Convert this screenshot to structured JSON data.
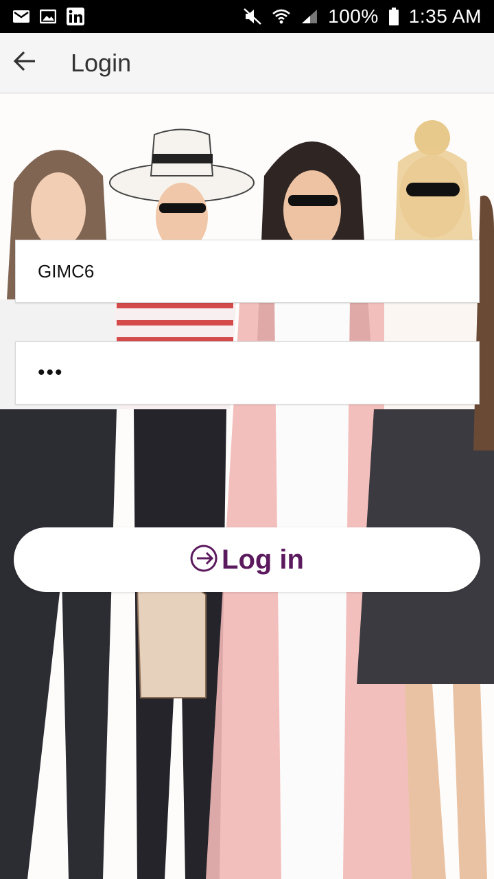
{
  "status_bar": {
    "left_icons": [
      "gmail-icon",
      "gallery-icon",
      "linkedin-icon"
    ],
    "right_icons": [
      "mute-icon",
      "wifi-icon",
      "signal-icon"
    ],
    "battery": "100%",
    "time": "1:35 AM"
  },
  "app_bar": {
    "title": "Login",
    "back_icon": "arrow-left-icon"
  },
  "form": {
    "username_value": "GIMC6",
    "password_value": "•••",
    "login_label": "Log in",
    "login_icon": "login-arrow-icon"
  },
  "colors": {
    "accent": "#5c1a5e",
    "app_bar_bg": "#f5f5f5",
    "status_bar_bg": "#000000"
  }
}
